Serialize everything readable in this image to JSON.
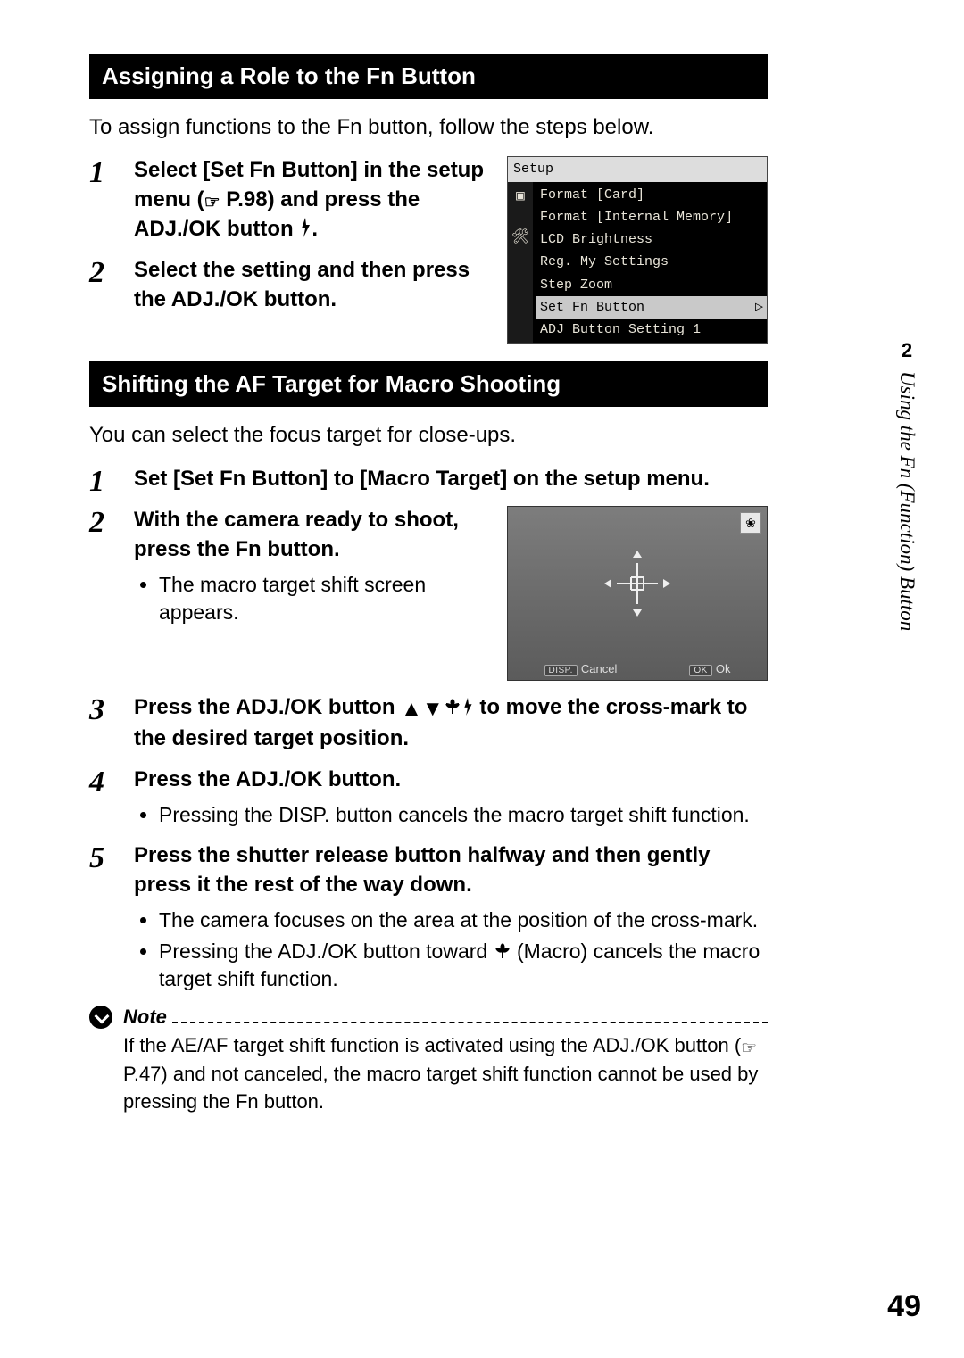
{
  "sections": {
    "assign": {
      "header": "Assigning a Role to the Fn Button",
      "lead": "To assign functions to the Fn button, follow the steps below.",
      "step1_a": "Select [Set Fn Button] in the setup menu (",
      "step1_ref": "P.98",
      "step1_b": ") and press the ADJ./OK button ",
      "step1_c": ".",
      "step2": "Select the setting and then press the ADJ./OK button."
    },
    "shift": {
      "header": "Shifting the AF Target for Macro Shooting",
      "lead": "You can select the focus target for close-ups.",
      "step1": "Set [Set Fn Button] to [Macro Target] on the setup menu.",
      "step2": "With the camera ready to shoot, press the Fn button.",
      "step2_sub1": "The macro target shift screen appears.",
      "step3_a": "Press the ADJ./OK button ",
      "step3_b": " to move the cross-mark to the desired target position.",
      "step4": "Press the ADJ./OK button.",
      "step4_sub1": "Pressing the DISP. button cancels the macro target shift function.",
      "step5": "Press the shutter release button halfway and then gently press it the rest of the way down.",
      "step5_sub1": "The camera focuses on the area at the position of the cross-mark.",
      "step5_sub2a": "Pressing the ADJ./OK button toward ",
      "step5_sub2b": " (Macro) cancels the macro target shift function."
    }
  },
  "setup_menu": {
    "title": "Setup",
    "items": [
      "Format [Card]",
      "Format [Internal Memory]",
      "LCD Brightness",
      "Reg. My Settings",
      "Step Zoom",
      "Set Fn Button",
      "ADJ Button Setting 1"
    ],
    "highlight_index": 5
  },
  "macro_screen": {
    "badge": "❀",
    "cancel_tag": "DISP.",
    "cancel": "Cancel",
    "ok_tag": "OK",
    "ok": "Ok"
  },
  "note": {
    "title": "Note",
    "text_a": "If the AE/AF target shift function is activated using the ADJ./OK button (",
    "text_ref": "P.47",
    "text_b": ") and not canceled, the macro target shift function cannot be used by pressing the Fn button."
  },
  "side": {
    "num": "2",
    "title": "Using the Fn (Function) Button"
  },
  "page_number": "49"
}
